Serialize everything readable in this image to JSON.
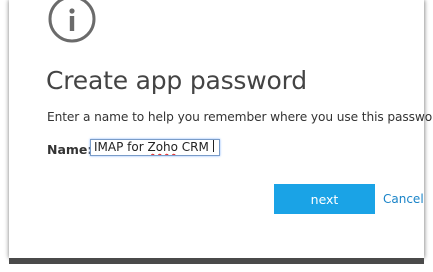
{
  "dialog": {
    "icon": "info-icon",
    "title": "Create app password",
    "description": "Enter a name to help you remember where you use this password.",
    "name_label": "Name:",
    "name_value_prefix": "IMAP for ",
    "name_value_misspelled": "Zoho",
    "name_value_suffix": " CRM",
    "next_label": "next",
    "cancel_label": "Cancel"
  },
  "colors": {
    "accent": "#1aa3e6",
    "link": "#1a84c8",
    "title_text": "#444444",
    "icon_stroke": "#6b6b6b",
    "spellcheck": "#e02020"
  }
}
